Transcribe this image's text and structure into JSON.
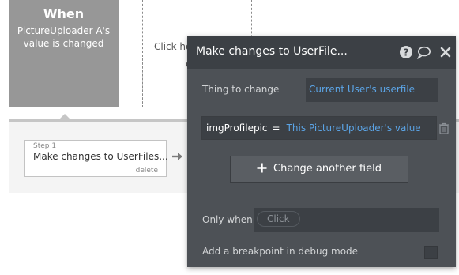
{
  "canvas": {
    "event_card": {
      "title": "When",
      "subtitle": "PictureUploader A's value is changed"
    },
    "empty_slot": {
      "text_line1": "Click he",
      "text_line2": "e"
    },
    "step": {
      "number_label": "Step 1",
      "title": "Make changes to UserFiles...",
      "delete_label": "delete"
    }
  },
  "panel": {
    "title": "Make changes to UserFile...",
    "icons": {
      "help": "question-circle-icon",
      "comment": "comment-icon",
      "close": "close-icon"
    },
    "thing_to_change": {
      "label": "Thing to change",
      "value": "Current User's userfile"
    },
    "field_row": {
      "key": "imgProfilepic",
      "operator": "=",
      "value": "This PictureUploader's value"
    },
    "change_another_field_label": "Change another field",
    "only_when": {
      "label": "Only when",
      "placeholder_chip": "Click"
    },
    "breakpoint": {
      "label": "Add a breakpoint in debug mode",
      "checked": false
    }
  },
  "colors": {
    "panel_bg": "#4d5156",
    "panel_header_bg": "#3c4045",
    "field_bg": "#3c4045",
    "link_blue": "#5ba4e6",
    "event_card_bg": "#979797"
  }
}
